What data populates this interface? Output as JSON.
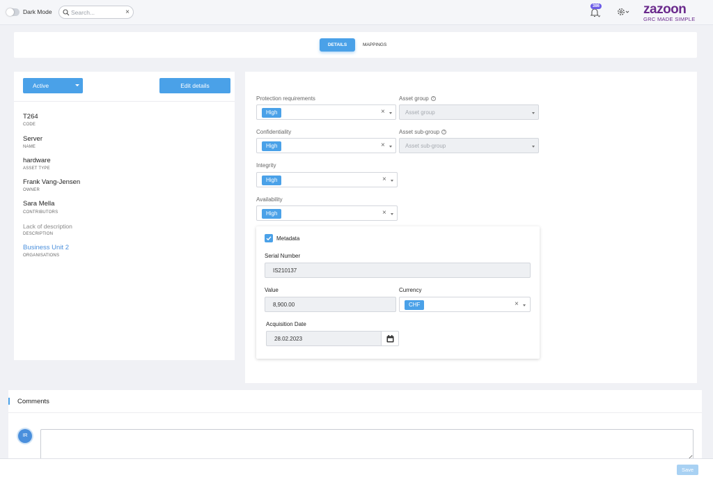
{
  "topbar": {
    "dark_mode_label": "Dark Mode",
    "search_placeholder": "Search...",
    "notification_count": "386",
    "brand_name": "zazoon",
    "brand_tagline": "GRC MADE SIMPLE"
  },
  "tabs": {
    "details": "DETAILS",
    "mappings": "MAPPINGS"
  },
  "left": {
    "status": "Active",
    "edit_label": "Edit details",
    "fields": [
      {
        "value": "T264",
        "key": "CODE"
      },
      {
        "value": "Server",
        "key": "NAME"
      },
      {
        "value": "hardware",
        "key": "ASSET TYPE"
      },
      {
        "value": "Frank Vang-Jensen",
        "key": "OWNER"
      },
      {
        "value": "Sara Mella",
        "key": "CONTRIBUTORS"
      },
      {
        "value": "Lack of description",
        "key": "DESCRIPTION"
      },
      {
        "value": "Business Unit 2",
        "key": "ORGANISATIONS"
      }
    ]
  },
  "form": {
    "protection_label": "Protection requirements",
    "protection_value": "High",
    "asset_group_label": "Asset group",
    "asset_group_placeholder": "Asset group",
    "confidentiality_label": "Confidentiality",
    "confidentiality_value": "High",
    "asset_subgroup_label": "Asset sub-group",
    "asset_subgroup_placeholder": "Asset sub-group",
    "integrity_label": "Integrity",
    "integrity_value": "High",
    "availability_label": "Availability",
    "availability_value": "High"
  },
  "metadata": {
    "title": "Metadata",
    "checked": true,
    "serial_label": "Serial Number",
    "serial_value": "IS210137",
    "value_label": "Value",
    "value_value": "8,900.00",
    "currency_label": "Currency",
    "currency_value": "CHF",
    "date_label": "Acquisition Date",
    "date_value": "28.02.2023"
  },
  "comments": {
    "title": "Comments",
    "avatar_initials": "IR",
    "save_label": "Save"
  },
  "colors": {
    "accent": "#4aa1e8",
    "brand": "#6a2a8c",
    "badge": "#6c5ce7"
  }
}
